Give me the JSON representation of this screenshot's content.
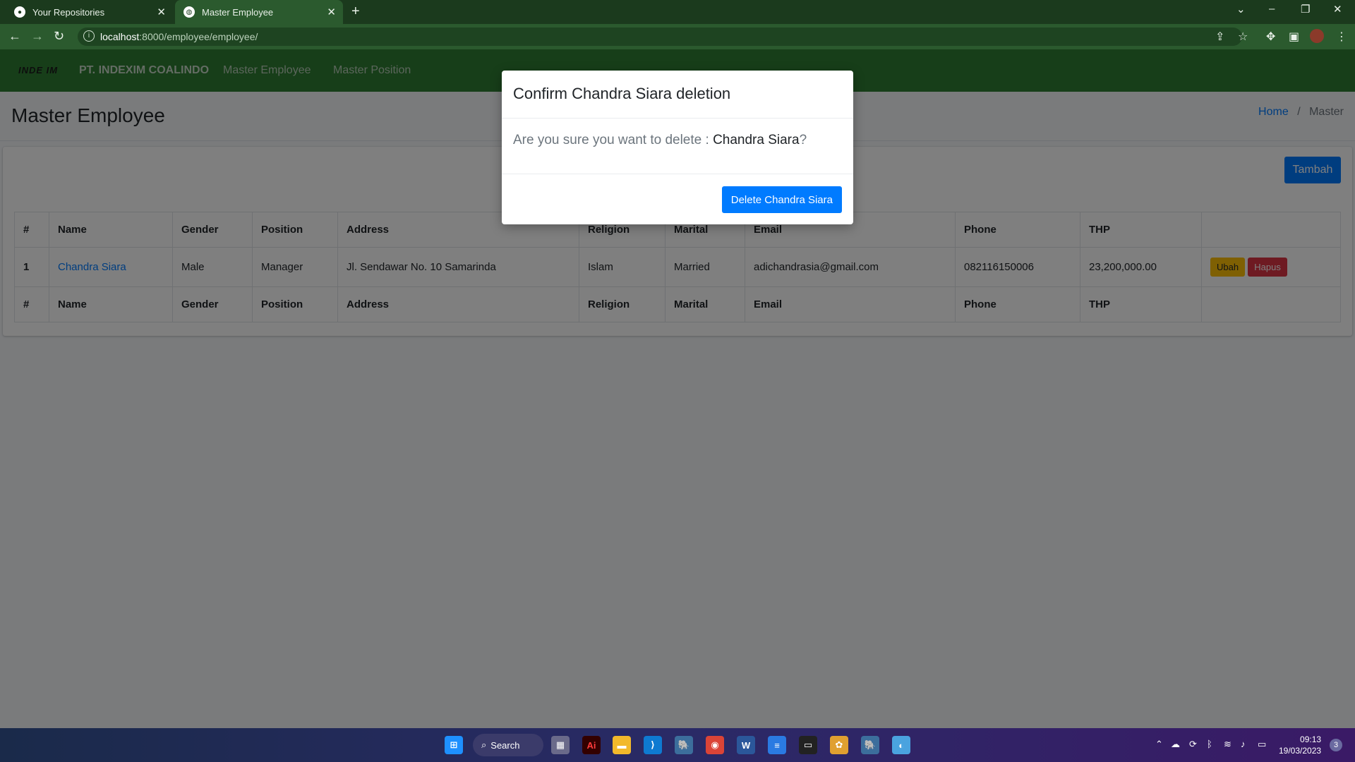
{
  "browser": {
    "tabs": [
      {
        "label": "Your Repositories"
      },
      {
        "label": "Master Employee"
      }
    ],
    "url_host": "localhost",
    "url_path": ":8000/employee/employee/"
  },
  "app": {
    "logo_text": "INDE IM",
    "brand": "PT. INDEXIM COALINDO",
    "nav": [
      "Master Employee",
      "Master Position"
    ]
  },
  "page": {
    "title": "Master Employee",
    "breadcrumb": {
      "home": "Home",
      "separator": "/",
      "current": "Master"
    },
    "add_button": "Tambah"
  },
  "table": {
    "headers": [
      "#",
      "Name",
      "Gender",
      "Position",
      "Address",
      "Religion",
      "Marital",
      "Email",
      "Phone",
      "THP",
      ""
    ],
    "rows": [
      {
        "no": "1",
        "name": "Chandra Siara",
        "gender": "Male",
        "position": "Manager",
        "address": "Jl. Sendawar No. 10 Samarinda",
        "religion": "Islam",
        "marital": "Married",
        "email": "adichandrasia@gmail.com",
        "phone": "082116150006",
        "thp": "23,200,000.00",
        "edit_label": "Ubah",
        "delete_label": "Hapus"
      }
    ]
  },
  "modal": {
    "title": "Confirm Chandra Siara deletion",
    "body_prefix": "Are you sure you want to delete : ",
    "body_name": "Chandra Siara",
    "body_suffix": "?",
    "confirm_label": "Delete Chandra Siara"
  },
  "taskbar": {
    "search_label": "Search",
    "time": "09:13",
    "date": "19/03/2023",
    "notifications": "3"
  },
  "colors": {
    "primary": "#007bff",
    "navbar": "#2e7d32",
    "warning": "#ffc107",
    "danger": "#dc3545"
  }
}
